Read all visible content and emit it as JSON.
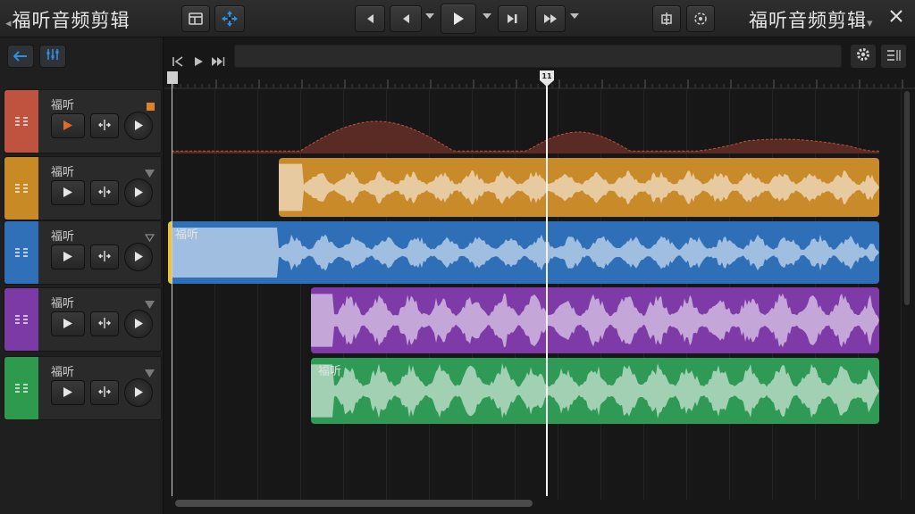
{
  "app": {
    "title_left": "福听音频剪辑",
    "title_right": "福听音频剪辑"
  },
  "toolbar": {
    "left_icons": [
      "window-layout-icon",
      "cursor-move-icon"
    ],
    "transport_icons": [
      "skip-back-icon",
      "step-back-icon",
      "play-icon",
      "jump-to-marker-icon",
      "fast-forward-icon"
    ],
    "right_icons": [
      "snap-icon",
      "loop-settings-icon"
    ]
  },
  "sidebar": {
    "back_icon": "back-arrow-icon",
    "mixer_icon": "mixer-icon"
  },
  "tracks": [
    {
      "name": "福听",
      "color": "#c0533f",
      "indicator": "square",
      "active": true
    },
    {
      "name": "福听",
      "color": "#c78a24",
      "indicator": "triangle",
      "active": false
    },
    {
      "name": "福听",
      "color": "#2f70b8",
      "indicator": "triangle-outline",
      "active": false
    },
    {
      "name": "福听",
      "color": "#7c3aa6",
      "indicator": "triangle",
      "active": false
    },
    {
      "name": "福听",
      "color": "#2e9a4e",
      "indicator": "triangle",
      "active": false
    }
  ],
  "clips": [
    {
      "track": 0,
      "type": "envelope",
      "label": "",
      "color": "#5a2a24"
    },
    {
      "track": 1,
      "label": "",
      "color": "#c98a2a"
    },
    {
      "track": 2,
      "label": "福听",
      "color": "#2e6fb8"
    },
    {
      "track": 3,
      "label": "",
      "color": "#7e3ba8"
    },
    {
      "track": 4,
      "label": "福听",
      "color": "#2f9a55"
    }
  ],
  "playhead": {
    "marker_label": "11"
  },
  "colors": {
    "accent": "#2f8fe0",
    "active_play": "#e06a2a",
    "background": "#161616"
  }
}
